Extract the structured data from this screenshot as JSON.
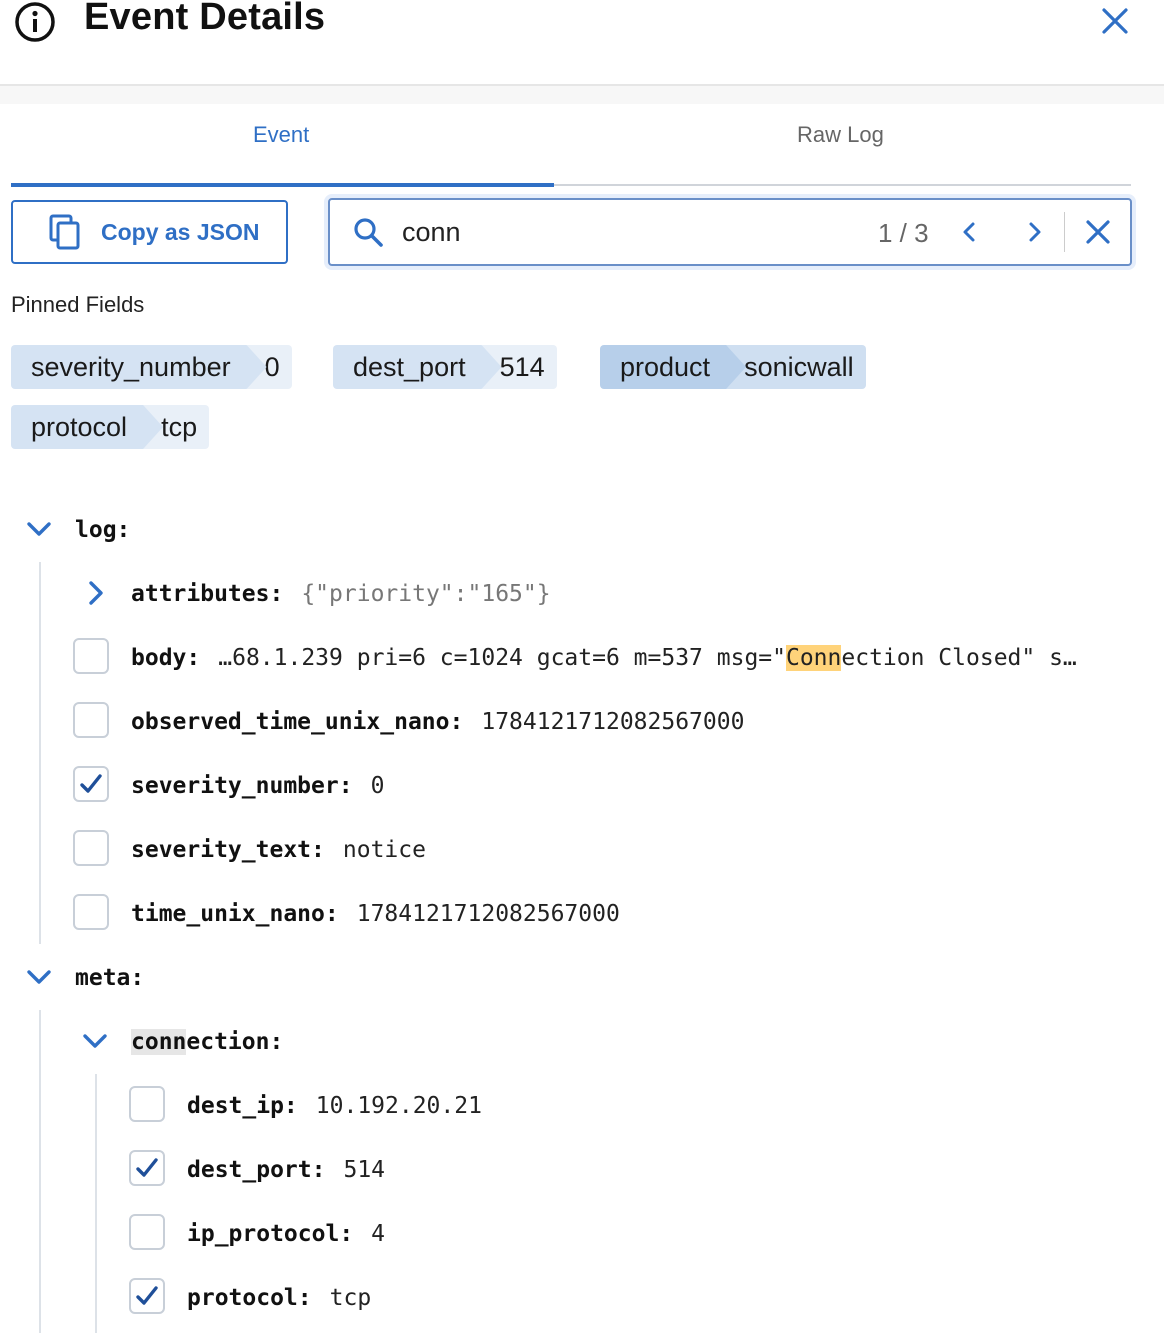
{
  "header": {
    "title": "Event Details"
  },
  "tabs": [
    {
      "label": "Event",
      "active": true
    },
    {
      "label": "Raw Log",
      "active": false
    }
  ],
  "toolbar": {
    "copy_label": "Copy as JSON",
    "search": {
      "value": "conn",
      "match_count": "1 / 3"
    }
  },
  "pinned": {
    "title": "Pinned Fields",
    "items": [
      {
        "key": "severity_number",
        "value": "0"
      },
      {
        "key": "dest_port",
        "value": "514"
      },
      {
        "key": "product",
        "value": "sonicwall"
      },
      {
        "key": "protocol",
        "value": "tcp"
      }
    ]
  },
  "tree": {
    "log": {
      "label": "log:",
      "attributes": {
        "key": "attributes:",
        "value": "{\"priority\":\"165\"}"
      },
      "body": {
        "key": "body:",
        "value_before": "…68.1.239 pri=6 c=1024 gcat=6 m=537 msg=\"",
        "value_match": "Conn",
        "value_after": "ection Closed\" s…"
      },
      "observed_time_unix_nano": {
        "key": "observed_time_unix_nano:",
        "value": "1784121712082567000",
        "checked": false
      },
      "severity_number": {
        "key": "severity_number:",
        "value": "0",
        "checked": true
      },
      "severity_text": {
        "key": "severity_text:",
        "value": "notice",
        "checked": false
      },
      "time_unix_nano": {
        "key": "time_unix_nano:",
        "value": "1784121712082567000",
        "checked": false
      }
    },
    "meta": {
      "label": "meta:",
      "connection": {
        "label_match": "conn",
        "label_rest": "ection:",
        "dest_ip": {
          "key": "dest_ip:",
          "value": "10.192.20.21",
          "checked": false
        },
        "dest_port": {
          "key": "dest_port:",
          "value": "514",
          "checked": true
        },
        "ip_protocol": {
          "key": "ip_protocol:",
          "value": "4",
          "checked": false
        },
        "protocol": {
          "key": "protocol:",
          "value": "tcp",
          "checked": true
        }
      }
    }
  },
  "colors": {
    "accent": "#2f6fc5",
    "highlight": "#ffd37a",
    "pill_key": "#d5e3f3",
    "pill_value": "#e9f0f8"
  }
}
